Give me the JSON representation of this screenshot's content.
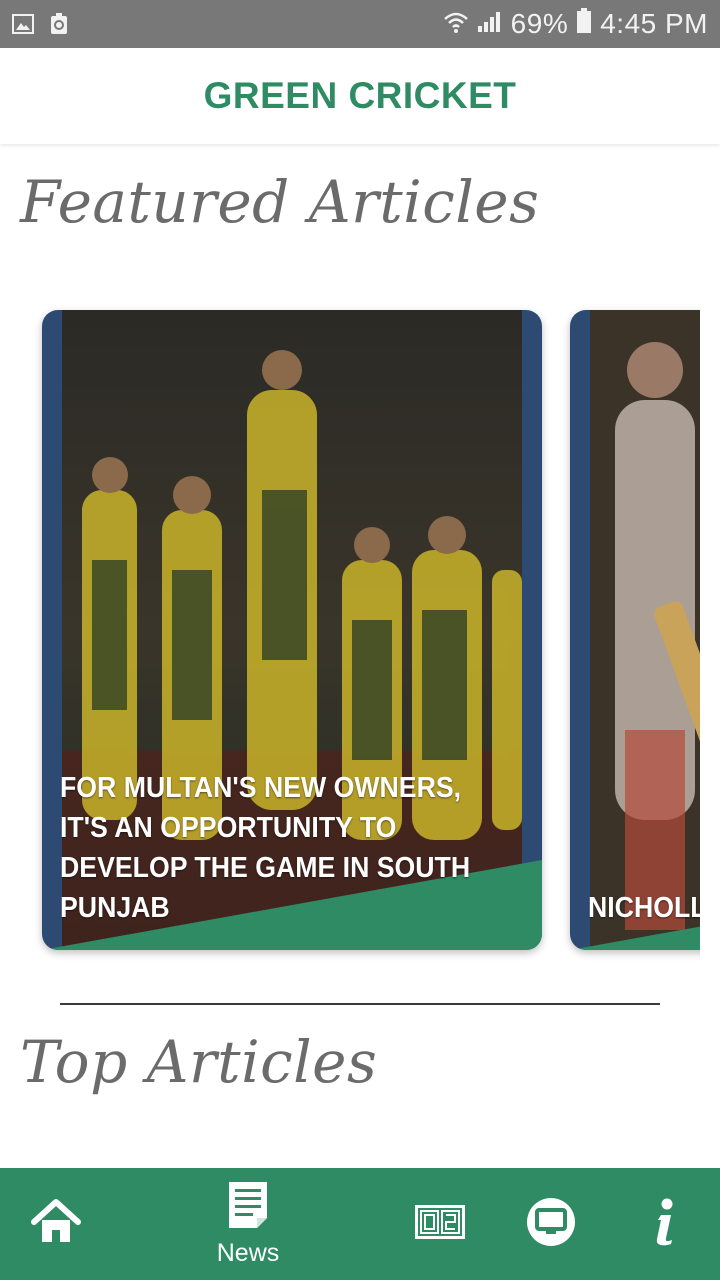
{
  "status_bar": {
    "battery": "69%",
    "time": "4:45 PM",
    "icons": [
      "gallery-icon",
      "recycle-icon",
      "wifi-icon",
      "signal-icon",
      "battery-icon"
    ]
  },
  "app_bar": {
    "title": "GREEN CRICKET"
  },
  "featured": {
    "heading": "Featured Articles",
    "cards": [
      {
        "title": "FOR MULTAN'S NEW OWNERS, IT'S AN OPPORTUNITY TO DEVELOP THE GAME IN SOUTH PUNJAB"
      },
      {
        "title": "NICHOLL MAKE SI"
      }
    ]
  },
  "top": {
    "heading": "Top Articles"
  },
  "bottom_nav": {
    "items": [
      {
        "icon": "home-icon",
        "label": ""
      },
      {
        "icon": "news-icon",
        "label": "News"
      },
      {
        "icon": "scoreboard-icon",
        "label": ""
      },
      {
        "icon": "tv-icon",
        "label": ""
      },
      {
        "icon": "info-icon",
        "label": ""
      }
    ]
  },
  "colors": {
    "brand_green": "#2e8b63",
    "card_blue": "#2d4a73",
    "status_bar": "#787878",
    "heading_gray": "#6b6b6b"
  }
}
